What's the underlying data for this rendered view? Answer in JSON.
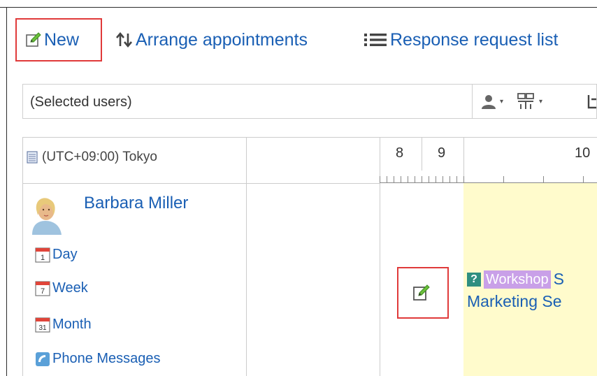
{
  "toolbar": {
    "new_label": "New",
    "arrange_label": "Arrange appointments",
    "response_label": "Response request list"
  },
  "users_bar": {
    "selected_text": "(Selected users)"
  },
  "timezone": {
    "label": "(UTC+09:00) Tokyo"
  },
  "hours": [
    "8",
    "9",
    "10"
  ],
  "user": {
    "name": "Barbara Miller",
    "links": {
      "day": "Day",
      "week": "Week",
      "month": "Month",
      "phone": "Phone Messages"
    },
    "calendar_numbers": {
      "day": "1",
      "week": "7",
      "month": "31"
    }
  },
  "event": {
    "status_mark": "?",
    "category": "Workshop",
    "title_start": "S",
    "title_line2": "Marketing Se"
  },
  "colors": {
    "link": "#1a5fb4",
    "highlight": "#e03a3a",
    "event_background": "#fffbcc",
    "category_badge": "#c9a0e8",
    "status_badge": "#2f8f80"
  },
  "icons": {
    "new": "edit-icon",
    "arrange": "arrange-arrows-icon",
    "response": "list-icon",
    "user_select": "person-icon",
    "facility_select": "facility-icon",
    "timezone": "timezone-icon",
    "add": "add-appointment-icon",
    "phone": "phone-icon"
  }
}
